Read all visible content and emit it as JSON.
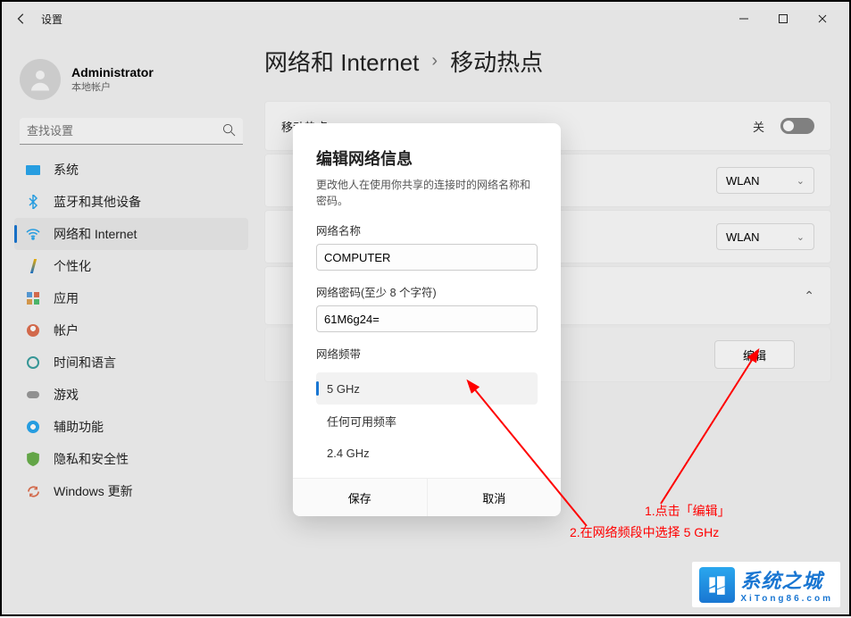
{
  "window": {
    "title": "设置"
  },
  "user": {
    "name": "Administrator",
    "sub": "本地帐户"
  },
  "search": {
    "placeholder": "查找设置"
  },
  "nav": {
    "items": [
      {
        "label": "系统"
      },
      {
        "label": "蓝牙和其他设备"
      },
      {
        "label": "网络和 Internet"
      },
      {
        "label": "个性化"
      },
      {
        "label": "应用"
      },
      {
        "label": "帐户"
      },
      {
        "label": "时间和语言"
      },
      {
        "label": "游戏"
      },
      {
        "label": "辅助功能"
      },
      {
        "label": "隐私和安全性"
      },
      {
        "label": "Windows 更新"
      }
    ]
  },
  "breadcrumb": {
    "a": "网络和 Internet",
    "b": "移动热点"
  },
  "cards": {
    "hotspot": {
      "label": "移动热点",
      "state": "关"
    },
    "share_from": {
      "value": "WLAN"
    },
    "share_over": {
      "value": "WLAN"
    },
    "edit_btn": "编辑"
  },
  "dialog": {
    "title": "编辑网络信息",
    "desc": "更改他人在使用你共享的连接时的网络名称和密码。",
    "name_label": "网络名称",
    "name_value": "COMPUTER",
    "pwd_label": "网络密码(至少 8 个字符)",
    "pwd_value": "61M6g24=",
    "band_label": "网络频带",
    "bands": [
      "5 GHz",
      "任何可用频率",
      "2.4 GHz"
    ],
    "save": "保存",
    "cancel": "取消"
  },
  "annotations": {
    "line1": "1.点击「编辑」",
    "line2": "2.在网络频段中选择 5 GHz"
  },
  "watermark": {
    "big": "系统之城",
    "sub": "XiTong86.com"
  }
}
